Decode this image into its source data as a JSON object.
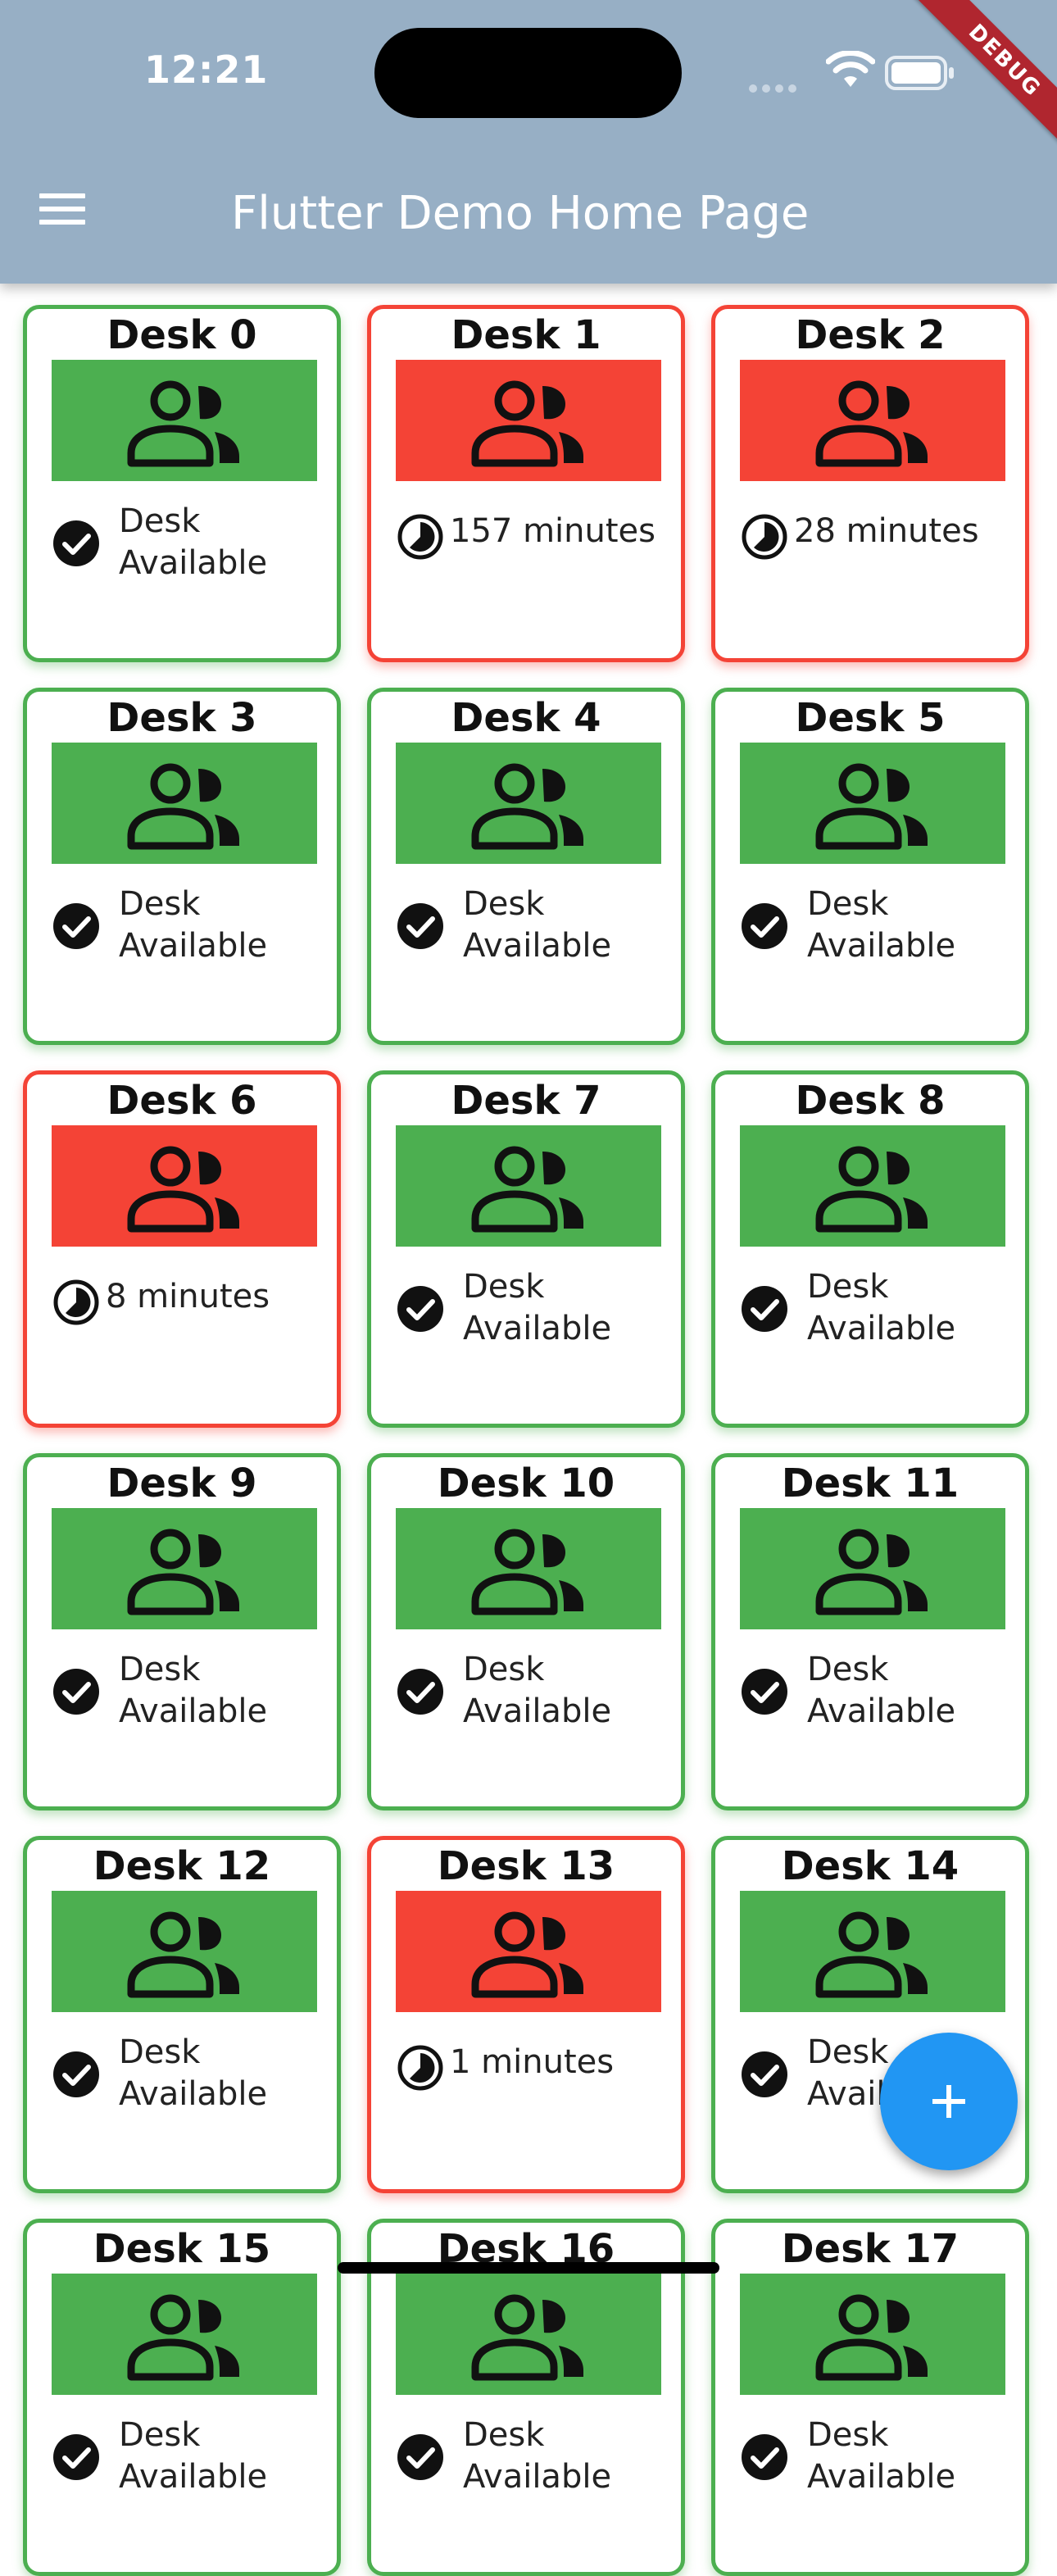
{
  "status_bar": {
    "time": "12:21"
  },
  "app_bar": {
    "title": "Flutter Demo Home Page",
    "debug_label": "DEBUG"
  },
  "desks": [
    {
      "name": "Desk 0",
      "status": "available",
      "line1": "Desk",
      "line2": "Available"
    },
    {
      "name": "Desk 1",
      "status": "occupied",
      "timer": "157 minutes"
    },
    {
      "name": "Desk 2",
      "status": "occupied",
      "timer": "28 minutes"
    },
    {
      "name": "Desk 3",
      "status": "available",
      "line1": "Desk",
      "line2": "Available"
    },
    {
      "name": "Desk 4",
      "status": "available",
      "line1": "Desk",
      "line2": "Available"
    },
    {
      "name": "Desk 5",
      "status": "available",
      "line1": "Desk",
      "line2": "Available"
    },
    {
      "name": "Desk 6",
      "status": "occupied",
      "timer": "8 minutes"
    },
    {
      "name": "Desk 7",
      "status": "available",
      "line1": "Desk",
      "line2": "Available"
    },
    {
      "name": "Desk 8",
      "status": "available",
      "line1": "Desk",
      "line2": "Available"
    },
    {
      "name": "Desk 9",
      "status": "available",
      "line1": "Desk",
      "line2": "Available"
    },
    {
      "name": "Desk 10",
      "status": "available",
      "line1": "Desk",
      "line2": "Available"
    },
    {
      "name": "Desk 11",
      "status": "available",
      "line1": "Desk",
      "line2": "Available"
    },
    {
      "name": "Desk 12",
      "status": "available",
      "line1": "Desk",
      "line2": "Available"
    },
    {
      "name": "Desk 13",
      "status": "occupied",
      "timer": "1 minutes"
    },
    {
      "name": "Desk 14",
      "status": "available",
      "line1": "Desk",
      "line2": "Available"
    },
    {
      "name": "Desk 15",
      "status": "available",
      "line1": "Desk",
      "line2": "Available"
    },
    {
      "name": "Desk 16",
      "status": "available",
      "line1": "Desk",
      "line2": "Available"
    },
    {
      "name": "Desk 17",
      "status": "available",
      "line1": "Desk",
      "line2": "Available"
    }
  ],
  "colors": {
    "available": "#4caf50",
    "occupied": "#f44336",
    "app_bar": "#97afc5",
    "fab": "#2196f3"
  },
  "icons": {
    "menu": "menu-icon",
    "people": "people-icon",
    "check": "check-circle-icon",
    "timer": "timelapse-icon",
    "fab": "add-icon"
  }
}
